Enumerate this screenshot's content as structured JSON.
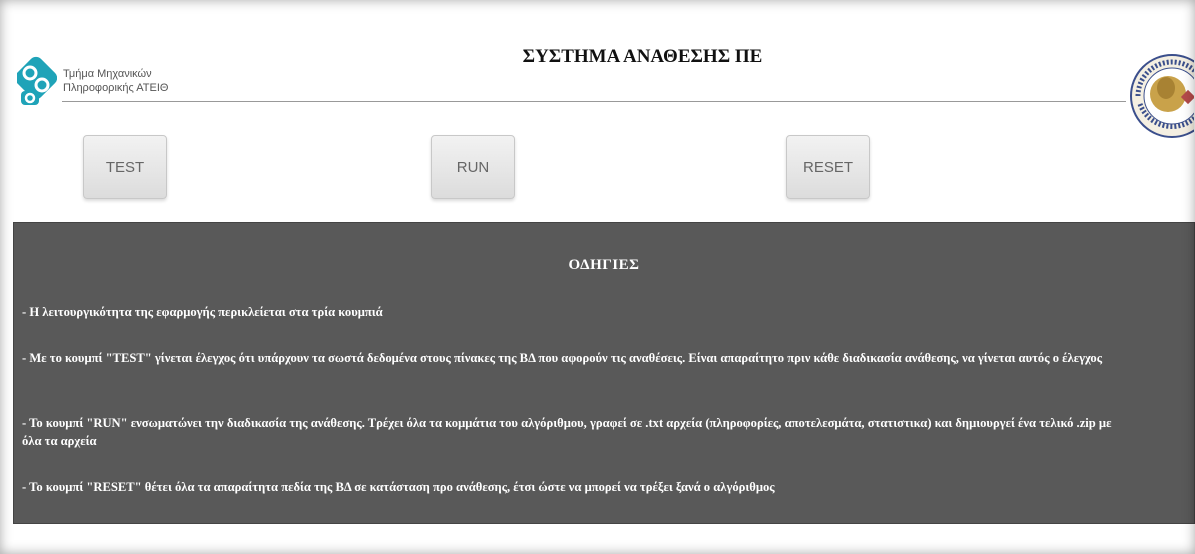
{
  "header": {
    "department_line1": "Τμήμα Μηχανικών",
    "department_line2": "Πληροφορικής ΑΤΕΙΘ",
    "title": "ΣΥΣΤΗΜΑ ΑΝΑΘΕΣΗΣ ΠΕ",
    "logo_icon": "department-logo-icon",
    "seal_icon": "university-seal-icon"
  },
  "buttons": {
    "test_label": "TEST",
    "run_label": "RUN",
    "reset_label": "RESET"
  },
  "instructions": {
    "heading": "ΟΔΗΓΙΕΣ",
    "items": [
      "- Η λειτουργικότητα της εφαρμογής περικλείεται στα τρία κουμπιά",
      "- Με το κουμπί \"TEST\" γίνεται έλεγχος ότι υπάρχουν τα σωστά δεδομένα στους πίνακες της ΒΔ που αφορούν τις αναθέσεις. Είναι απαραίτητο πριν κάθε διαδικασία ανάθεσης, να γίνεται αυτός ο έλεγχος",
      "- Το κουμπί \"RUN\" ενσωματώνει την διαδικασία της ανάθεσης. Τρέχει όλα τα κομμάτια του αλγόριθμου, γραφεί σε .txt αρχεία (πληροφορίες, αποτελεσμάτα, στατιστικα) και δημιουργεί ένα τελικό .zip με όλα τα αρχεία",
      "- Το κουμπί \"RESET\" θέτει όλα τα απαραίτητα πεδία της ΒΔ σε κατάσταση προ ανάθεσης, έτσι ώστε να μπορεί να τρέξει ξανά ο αλγόριθμος"
    ]
  },
  "colors": {
    "panel_bg": "#595959",
    "logo_teal": "#1fa3b8",
    "seal_gold": "#c9a24a",
    "seal_blue": "#3b4f8c"
  }
}
